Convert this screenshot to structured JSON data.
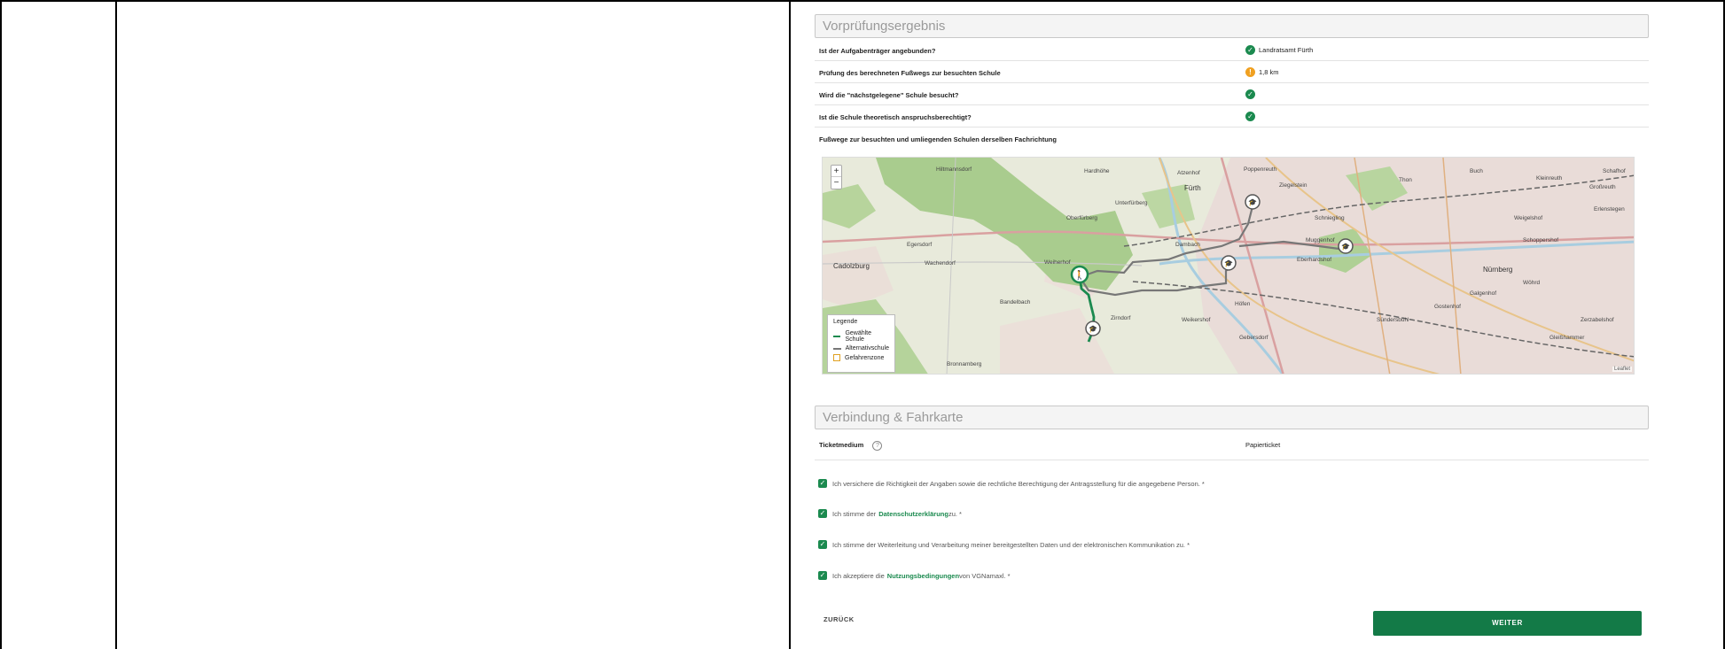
{
  "prefcheck": {
    "title": "Vorprüfungsergebnis",
    "rows": [
      {
        "question": "Ist der Aufgabenträger angebunden?",
        "status": "ok",
        "answer": "Landratsamt Fürth"
      },
      {
        "question": "Prüfung des berechneten Fußwegs zur besuchten Schule",
        "status": "warn",
        "answer": "1,8 km"
      },
      {
        "question": "Wird die \"nächstgelegene\" Schule besucht?",
        "status": "ok",
        "answer": ""
      },
      {
        "question": "Ist die Schule theoretisch anspruchsberechtigt?",
        "status": "ok",
        "answer": ""
      }
    ],
    "map_caption": "Fußwege zur besuchten und umliegenden Schulen derselben Fachrichtung"
  },
  "map": {
    "zoom_in": "+",
    "zoom_out": "−",
    "legend_title": "Legende",
    "legend": [
      {
        "label": "Gewählte Schule",
        "color": "#1b8a4f"
      },
      {
        "label": "Alternativschule",
        "color": "#777777"
      },
      {
        "label": "Gefahrenzone",
        "color": "#e0a020"
      }
    ],
    "attribution": "Leaflet",
    "places": [
      "Hiltmannsdorf",
      "Hardhöhe",
      "Atzenhof",
      "Poppenreuth",
      "Fürth",
      "Oberfürberg",
      "Unterfürberg",
      "Dambach",
      "Weikershof",
      "Ziegelstein",
      "Cadolzburg",
      "Wachendorf",
      "Egersdorf",
      "Weiherhof",
      "Bandelbach",
      "Zirndorf",
      "Nürnberg",
      "Sündersbühl",
      "Gostenhof",
      "Kleinreuth",
      "Großreuth",
      "Schoppershof",
      "Wöhrd",
      "Galgenhof",
      "Gleißhammer",
      "Zerzabelshof",
      "Bronnamberg",
      "Höfen",
      "Gebersdorf",
      "Schniegling",
      "Muggenhof",
      "Eberhardshof",
      "Thon",
      "Buch",
      "Erlenstegen",
      "Schafhof",
      "Weigelshof"
    ]
  },
  "connection": {
    "title": "Verbindung & Fahrkarte",
    "ticket_label": "Ticketmedium",
    "ticket_value": "Papierticket"
  },
  "consents": {
    "c1": "Ich versichere die Richtigkeit der Angaben sowie die rechtliche Berechtigung der Antragsstellung für die angegebene Person. *",
    "c2_pre": "Ich stimme der ",
    "c2_link": "Datenschutzerklärung",
    "c2_post": " zu. *",
    "c3": "Ich stimme der Weiterleitung und Verarbeitung meiner bereitgestellten Daten und der elektronischen Kommunikation zu. *",
    "c4_pre": "Ich akzeptiere die ",
    "c4_link": "Nutzungsbedingungen",
    "c4_post": " von VGNamaxl. *"
  },
  "actions": {
    "back": "ZURÜCK",
    "next": "WEITER"
  }
}
